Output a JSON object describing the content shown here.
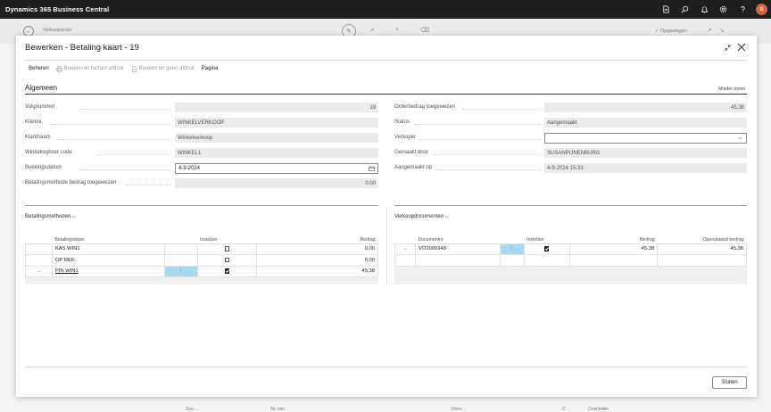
{
  "app": {
    "title": "Dynamics 365 Business Central",
    "user_initial": "S"
  },
  "topbar_icons": [
    "document-icon",
    "search-icon",
    "bell-icon",
    "gear-icon",
    "help-icon"
  ],
  "background": {
    "page_title": "Verkooporder",
    "saved_label": "Opgeslagen",
    "bottom_cols": [
      "Spe...",
      "Nr. van",
      "Hoev...",
      "C",
      "Overleden"
    ]
  },
  "dialog": {
    "title": "Bewerken - Betaling kaart - 19",
    "actions": [
      {
        "label": "Beheren",
        "enabled": true
      },
      {
        "label": "Boeken en factuur afdruk",
        "enabled": false,
        "icon": "print-icon"
      },
      {
        "label": "Boeken en geen afdruk",
        "enabled": false,
        "icon": "post-icon"
      },
      {
        "label": "Pagina",
        "enabled": true
      }
    ],
    "section": {
      "title": "Algemeen",
      "toggle_label": "Minder tonen"
    },
    "fields_left": [
      {
        "label": "Volgnummer",
        "value": "19",
        "align": "right"
      },
      {
        "label": "Klantnr.",
        "value": "WINKELVERKOOP",
        "align": "left"
      },
      {
        "label": "Klantnaam",
        "value": "Winkelverkoop",
        "align": "left"
      },
      {
        "label": "Winkelregister code",
        "value": "WINKEL1",
        "align": "left"
      },
      {
        "label": "Boekingsdatum",
        "value": "4-9-2024",
        "align": "left"
      },
      {
        "label": "Betalingsmethode bedrag toegewezen",
        "value": "0.00",
        "align": "right"
      }
    ],
    "fields_right": [
      {
        "label": "Orderbedrag toegewezen",
        "value": "45,38",
        "align": "right"
      },
      {
        "label": "Status",
        "value": "Aangemaakt",
        "align": "left"
      },
      {
        "label": "Verkoper",
        "value": "",
        "align": "left"
      },
      {
        "label": "Gemaakt door",
        "value": "SUSANPIJNENBURG",
        "align": "left"
      },
      {
        "label": "Aangemaakt op",
        "value": "4-9-2024 15:33",
        "align": "left"
      }
    ],
    "payment_methods": {
      "title": "Betalingsmethoden",
      "columns": [
        "Betalingswijze",
        "Instellen",
        "Bedrag"
      ],
      "rows": [
        {
          "name": "KAS WIN1",
          "set": false,
          "amount": "0,00"
        },
        {
          "name": "OP REK.",
          "set": false,
          "amount": "0,00"
        },
        {
          "name": "PIN WIN1",
          "set": true,
          "amount": "45,38"
        }
      ]
    },
    "sales_docs": {
      "title": "Verkoopdocumenten",
      "columns": [
        "Documentnr.",
        "Instellen",
        "Bedrag",
        "Openstaand bedrag"
      ],
      "rows": [
        {
          "doc": "VO2000349",
          "set": true,
          "amount": "45,38",
          "open": "45,38"
        }
      ]
    },
    "close_label": "Sluiten"
  }
}
